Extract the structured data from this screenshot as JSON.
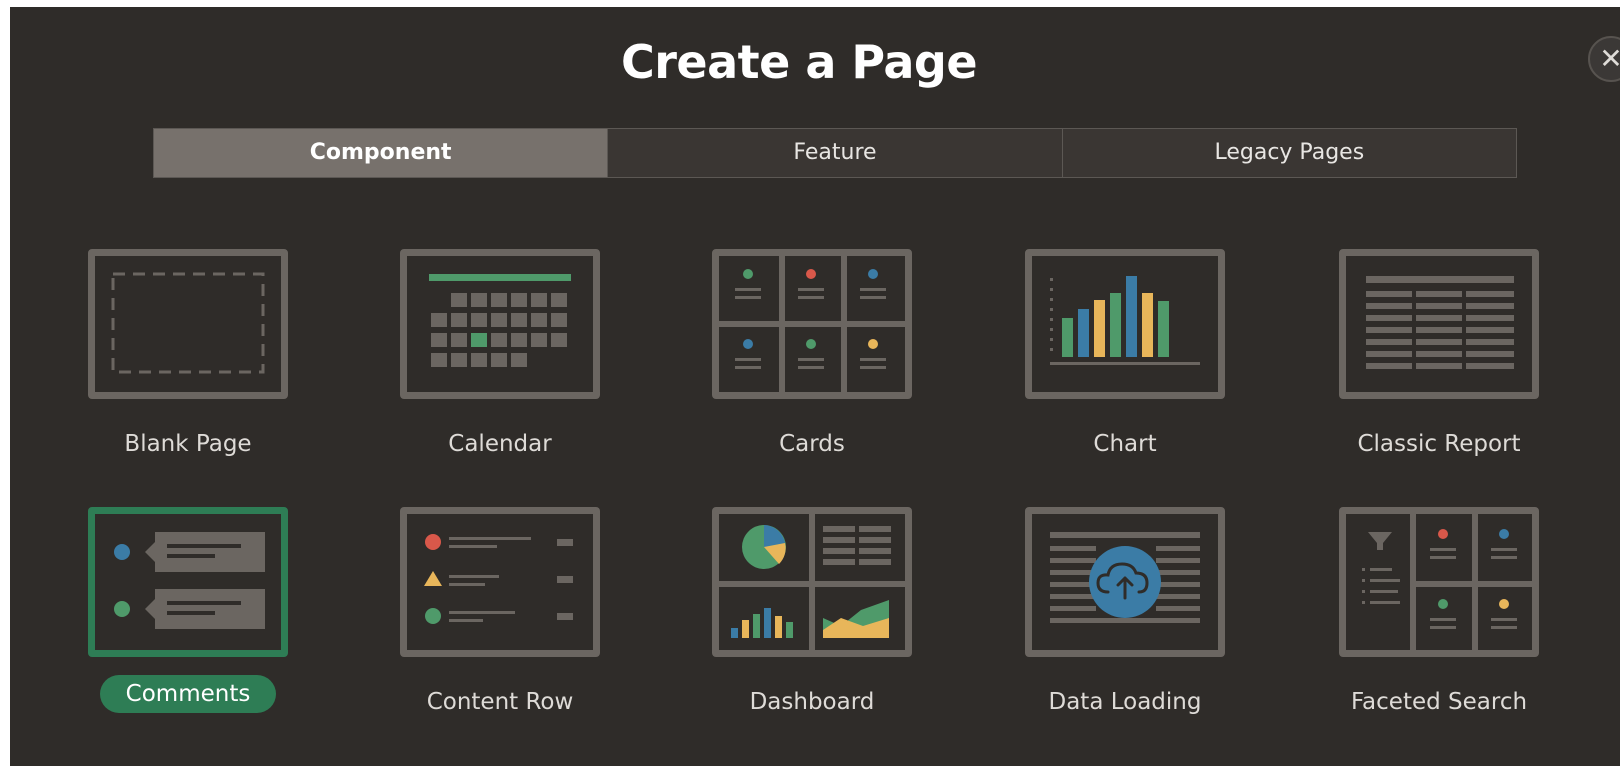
{
  "dialog": {
    "title": "Create a Page",
    "close_icon": "close-icon"
  },
  "tabs": [
    {
      "label": "Component",
      "active": true
    },
    {
      "label": "Feature",
      "active": false
    },
    {
      "label": "Legacy Pages",
      "active": false
    }
  ],
  "components": [
    {
      "label": "Blank Page",
      "icon": "blank-page-icon"
    },
    {
      "label": "Calendar",
      "icon": "calendar-icon"
    },
    {
      "label": "Cards",
      "icon": "cards-icon"
    },
    {
      "label": "Chart",
      "icon": "chart-icon"
    },
    {
      "label": "Classic Report",
      "icon": "classic-report-icon"
    },
    {
      "label": "Comments",
      "icon": "comments-icon",
      "selected": true
    },
    {
      "label": "Content Row",
      "icon": "content-row-icon"
    },
    {
      "label": "Dashboard",
      "icon": "dashboard-icon"
    },
    {
      "label": "Data Loading",
      "icon": "data-loading-icon"
    },
    {
      "label": "Faceted Search",
      "icon": "faceted-search-icon"
    }
  ],
  "colors": {
    "background": "#2f2c29",
    "thumb_border": "#6b6661",
    "selected_accent": "#2e7d55",
    "green": "#4f9a6a",
    "red": "#d9584a",
    "yellow": "#e8b65a",
    "blue": "#3b7ca6"
  }
}
